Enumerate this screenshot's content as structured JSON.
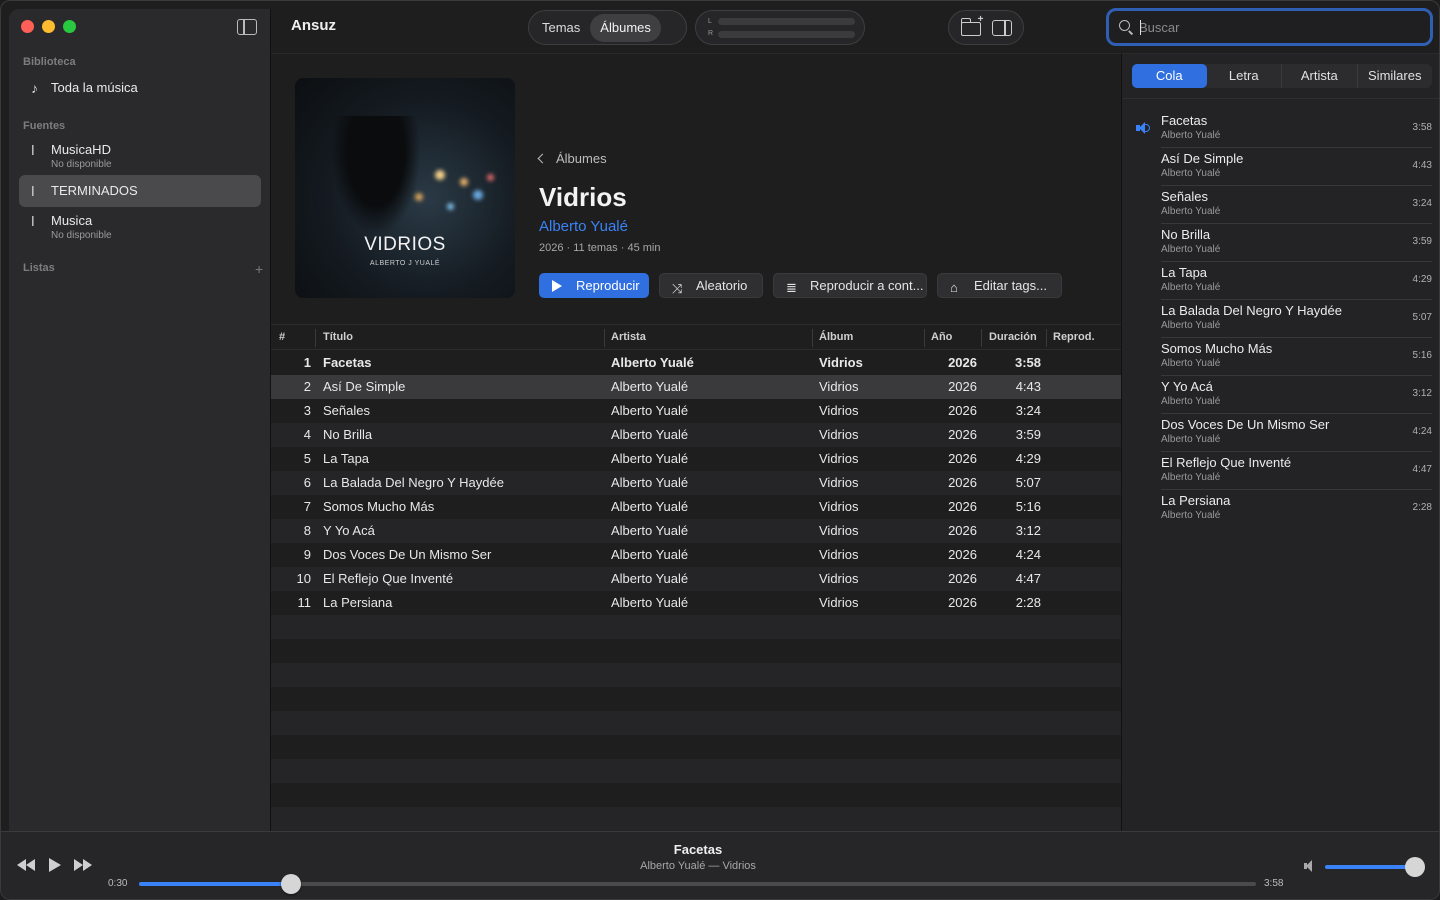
{
  "app": {
    "title": "Ansuz"
  },
  "sidebar": {
    "library_header": "Biblioteca",
    "all_music": "Toda la música",
    "sources_header": "Fuentes",
    "sources": [
      {
        "name": "MusicaHD",
        "status": "No disponible"
      },
      {
        "name": "TERMINADOS",
        "status": ""
      },
      {
        "name": "Musica",
        "status": "No disponible"
      }
    ],
    "lists_header": "Listas",
    "add_symbol": "+"
  },
  "toolbar": {
    "view_tabs": [
      "Temas",
      "Álbumes"
    ],
    "active_view": "Álbumes",
    "meter_left": "L",
    "meter_right": "R",
    "search_placeholder": "Buscar"
  },
  "album": {
    "back_label": "Álbumes",
    "title": "Vidrios",
    "artist": "Alberto Yualé",
    "meta": "2026 · 11 temas · 45 min",
    "cover_title": "VIDRIOS",
    "cover_subtitle": "ALBERTO J YUALÉ",
    "actions": {
      "play": "Reproducir",
      "shuffle": "Aleatorio",
      "play_next": "Reproducir a cont...",
      "edit_tags": "Editar tags..."
    }
  },
  "table": {
    "headers": {
      "num": "#",
      "title": "Título",
      "artist": "Artista",
      "album": "Álbum",
      "year": "Año",
      "duration": "Duración",
      "plays": "Reprod."
    },
    "rows": [
      {
        "num": "1",
        "title": "Facetas",
        "artist": "Alberto Yualé",
        "album": "Vidrios",
        "year": "2026",
        "duration": "3:58"
      },
      {
        "num": "2",
        "title": "Así De Simple",
        "artist": "Alberto Yualé",
        "album": "Vidrios",
        "year": "2026",
        "duration": "4:43"
      },
      {
        "num": "3",
        "title": "Señales",
        "artist": "Alberto Yualé",
        "album": "Vidrios",
        "year": "2026",
        "duration": "3:24"
      },
      {
        "num": "4",
        "title": "No Brilla",
        "artist": "Alberto Yualé",
        "album": "Vidrios",
        "year": "2026",
        "duration": "3:59"
      },
      {
        "num": "5",
        "title": "La Tapa",
        "artist": "Alberto Yualé",
        "album": "Vidrios",
        "year": "2026",
        "duration": "4:29"
      },
      {
        "num": "6",
        "title": "La Balada Del Negro Y Haydée",
        "artist": "Alberto Yualé",
        "album": "Vidrios",
        "year": "2026",
        "duration": "5:07"
      },
      {
        "num": "7",
        "title": "Somos Mucho Más",
        "artist": "Alberto Yualé",
        "album": "Vidrios",
        "year": "2026",
        "duration": "5:16"
      },
      {
        "num": "8",
        "title": "Y Yo Acá",
        "artist": "Alberto Yualé",
        "album": "Vidrios",
        "year": "2026",
        "duration": "3:12"
      },
      {
        "num": "9",
        "title": "Dos Voces De Un Mismo Ser",
        "artist": "Alberto Yualé",
        "album": "Vidrios",
        "year": "2026",
        "duration": "4:24"
      },
      {
        "num": "10",
        "title": "El Reflejo Que Inventé",
        "artist": "Alberto Yualé",
        "album": "Vidrios",
        "year": "2026",
        "duration": "4:47"
      },
      {
        "num": "11",
        "title": "La Persiana",
        "artist": "Alberto Yualé",
        "album": "Vidrios",
        "year": "2026",
        "duration": "2:28"
      }
    ]
  },
  "right_panel": {
    "tabs": [
      "Cola",
      "Letra",
      "Artista",
      "Similares"
    ],
    "active_tab": "Cola",
    "queue": [
      {
        "title": "Facetas",
        "artist": "Alberto Yualé",
        "duration": "3:58"
      },
      {
        "title": "Así De Simple",
        "artist": "Alberto Yualé",
        "duration": "4:43"
      },
      {
        "title": "Señales",
        "artist": "Alberto Yualé",
        "duration": "3:24"
      },
      {
        "title": "No Brilla",
        "artist": "Alberto Yualé",
        "duration": "3:59"
      },
      {
        "title": "La Tapa",
        "artist": "Alberto Yualé",
        "duration": "4:29"
      },
      {
        "title": "La Balada Del Negro Y Haydée",
        "artist": "Alberto Yualé",
        "duration": "5:07"
      },
      {
        "title": "Somos Mucho Más",
        "artist": "Alberto Yualé",
        "duration": "5:16"
      },
      {
        "title": "Y Yo Acá",
        "artist": "Alberto Yualé",
        "duration": "3:12"
      },
      {
        "title": "Dos Voces De Un Mismo Ser",
        "artist": "Alberto Yualé",
        "duration": "4:24"
      },
      {
        "title": "El Reflejo Que Inventé",
        "artist": "Alberto Yualé",
        "duration": "4:47"
      },
      {
        "title": "La Persiana",
        "artist": "Alberto Yualé",
        "duration": "2:28"
      }
    ]
  },
  "player": {
    "now_playing_title": "Facetas",
    "now_playing_sub": "Alberto Yualé — Vidrios",
    "elapsed": "0:30",
    "total": "3:58",
    "progress_fraction": 0.136,
    "volume_fraction": 1.0
  },
  "colors": {
    "accent": "#3a82f7",
    "button_primary": "#2f6fe0"
  },
  "icons": {
    "toolbar": [
      "sidebar-toggle-icon",
      "folder-add-icon",
      "panel-right-icon",
      "search-icon"
    ],
    "sidebar": [
      "music-note-icon",
      "source-icon"
    ],
    "player": [
      "rewind-icon",
      "play-icon",
      "fast-forward-icon",
      "volume-icon"
    ]
  }
}
